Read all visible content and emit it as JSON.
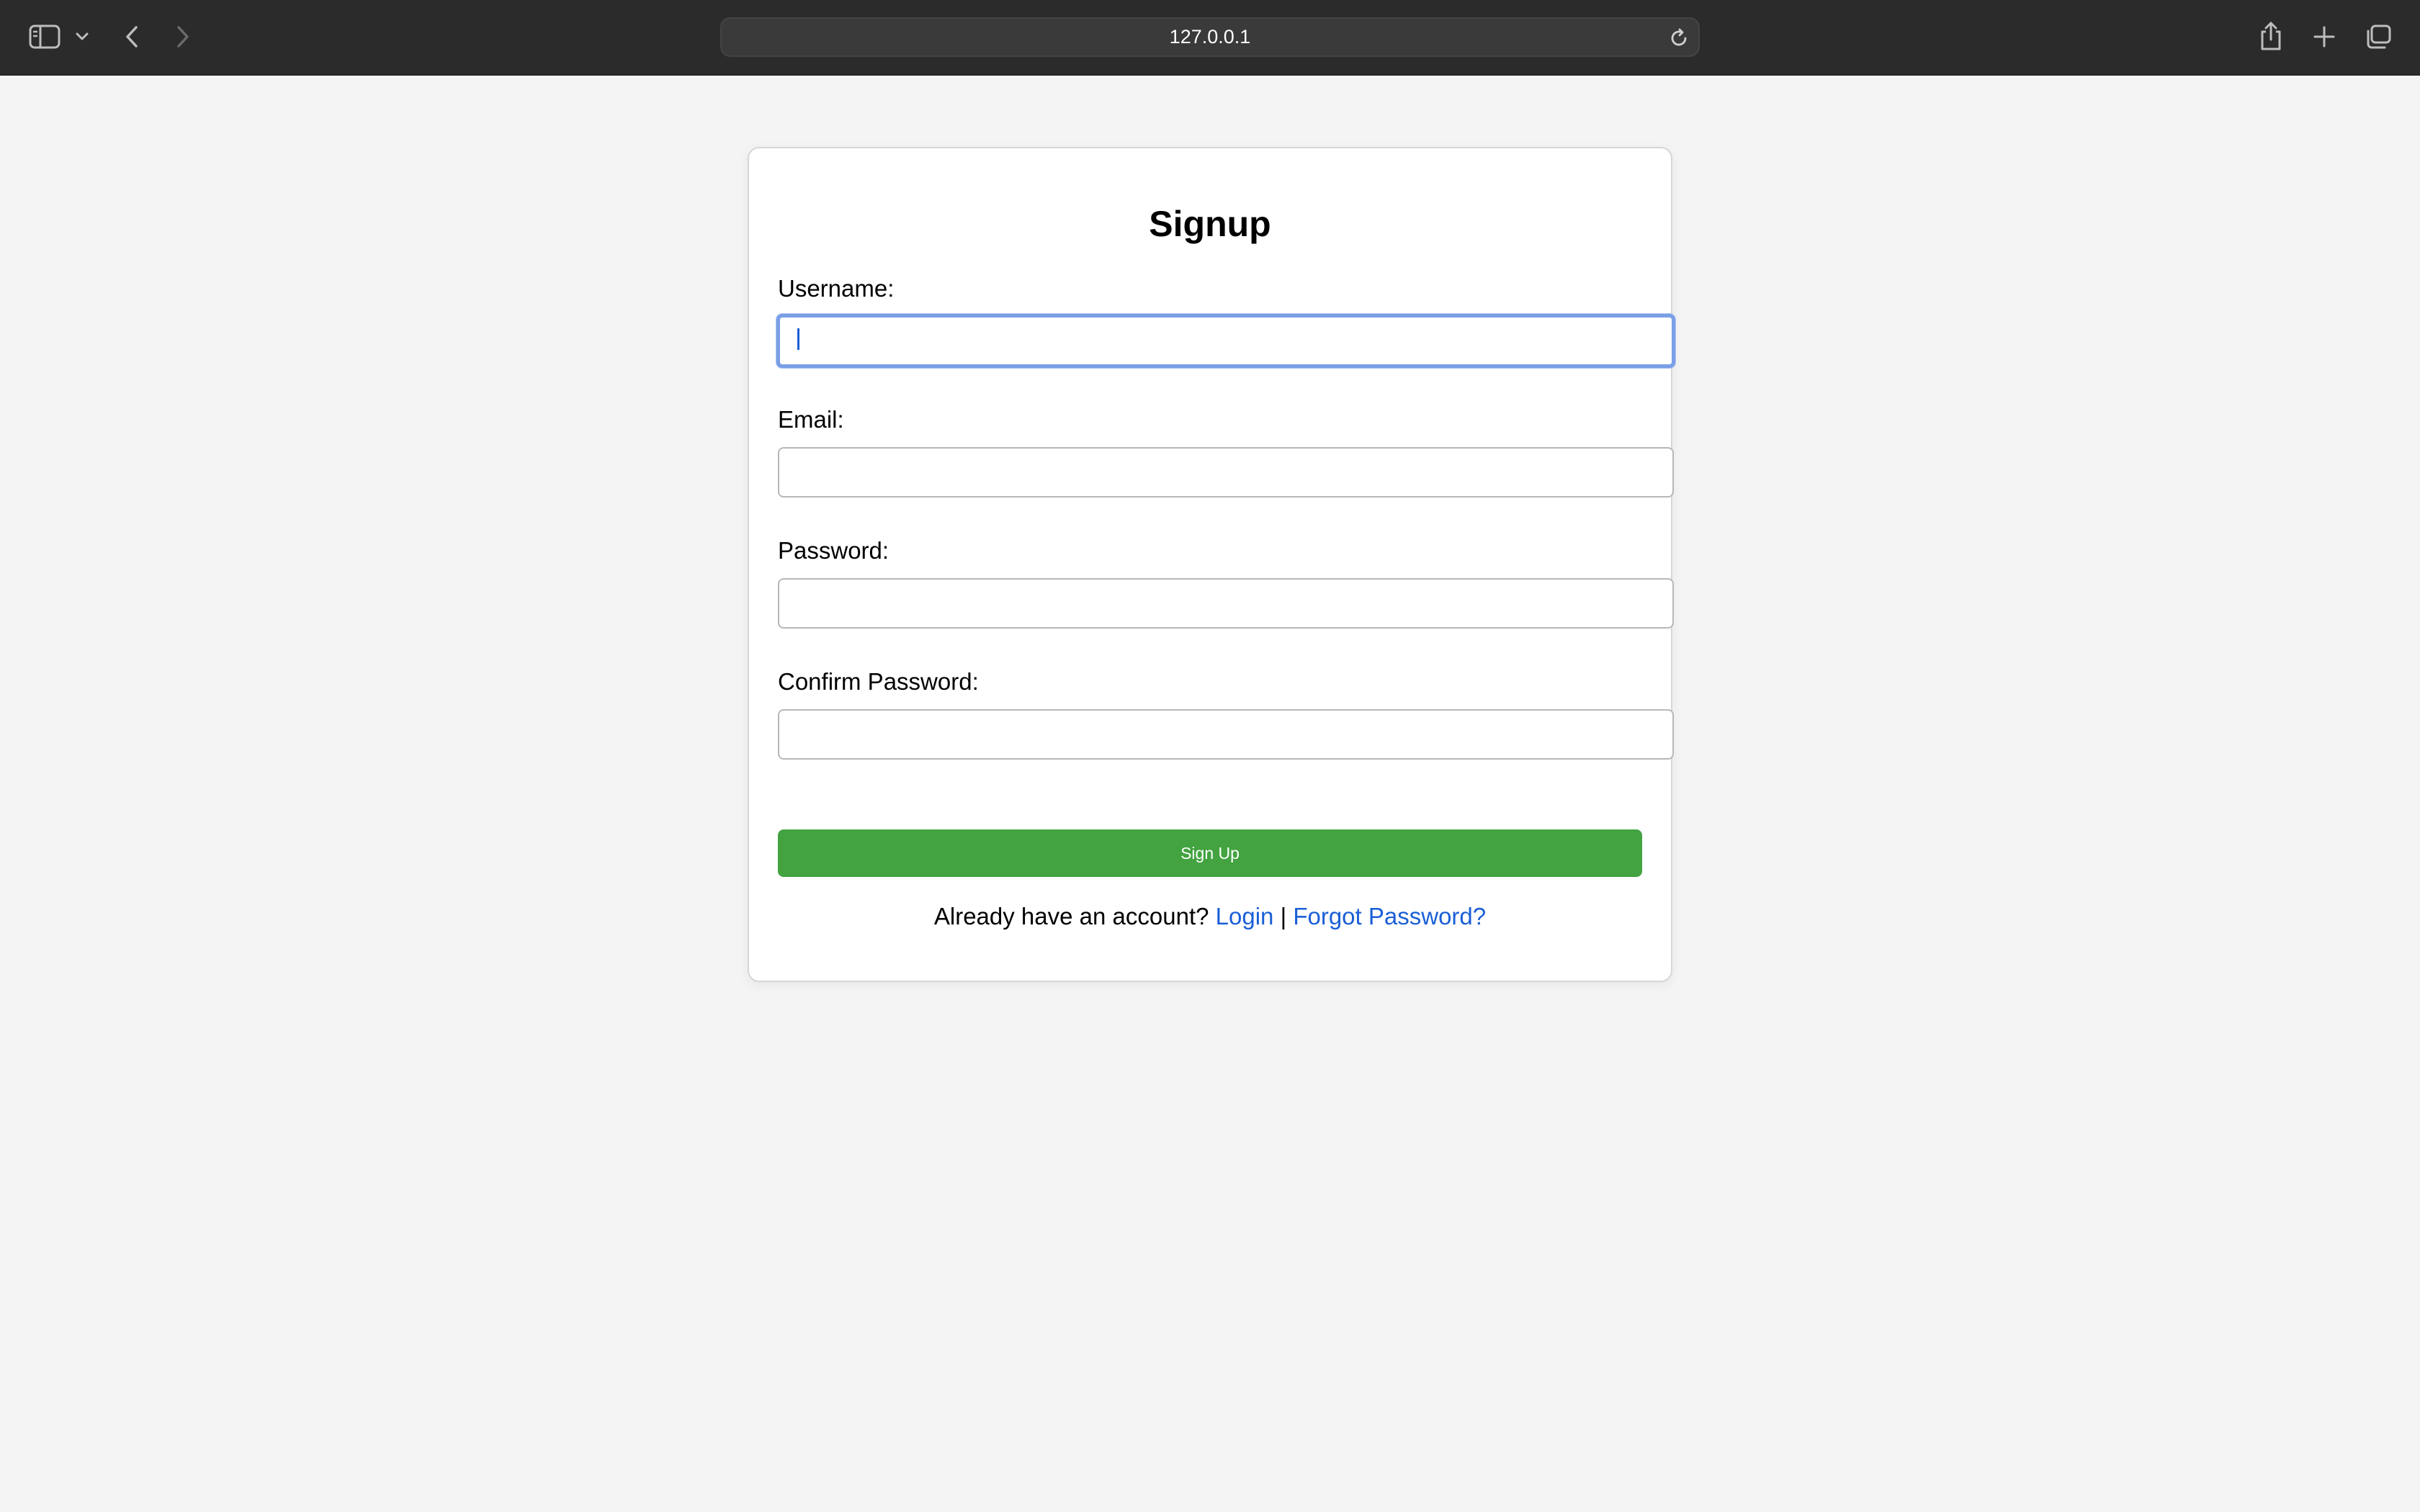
{
  "browser": {
    "url": "127.0.0.1",
    "icons": {
      "sidebar": "sidebar-icon",
      "sidebar_menu": "chevron-down-icon",
      "back": "back-icon",
      "forward": "forward-icon",
      "reload": "reload-icon",
      "share": "share-icon",
      "new_tab": "plus-icon",
      "tab_overview": "tabs-icon"
    }
  },
  "form": {
    "title": "Signup",
    "fields": [
      {
        "label": "Username:",
        "value": "",
        "focused": true
      },
      {
        "label": "Email:",
        "value": ""
      },
      {
        "label": "Password:",
        "value": ""
      },
      {
        "label": "Confirm Password:",
        "value": ""
      }
    ],
    "submit_label": "Sign Up",
    "footer_text": "Already have an account?",
    "login_link": "Login",
    "separator": "|",
    "forgot_link": "Forgot Password?"
  },
  "colors": {
    "button_green": "#42a340",
    "link_blue": "#1a5fd6",
    "focus_ring": "#7a9fe6"
  }
}
